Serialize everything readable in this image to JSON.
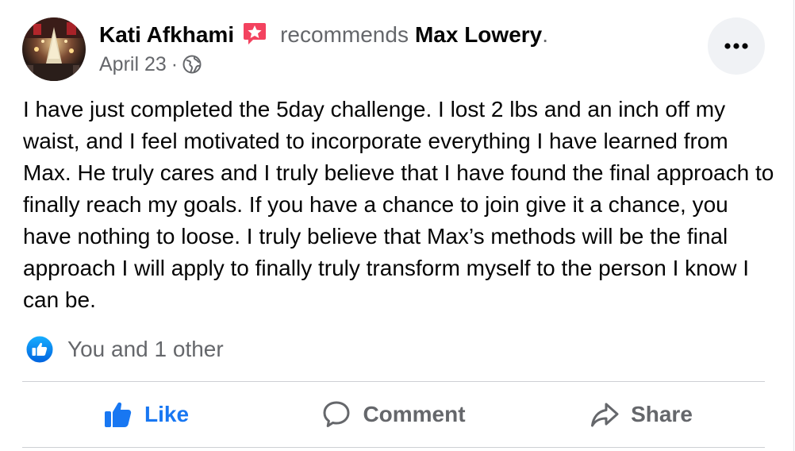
{
  "post": {
    "author": "Kati Afkhami",
    "action_text": "recommends",
    "page_name": "Max Lowery",
    "period": ".",
    "date": "April 23",
    "separator": "·",
    "audience_icon": "globe-icon",
    "more_icon": "more-horizontal-icon",
    "body": "I have just completed the 5day challenge. I lost 2 lbs and an inch off my waist, and I feel motivated to incorporate everything I have learned from Max. He truly cares and I truly believe that I have found the final approach to finally reach my goals. If you have a chance to join give it a chance, you have nothing to loose. I truly believe that Max’s methods will be the final approach I will apply to finally truly transform myself to the person I know I can be."
  },
  "reactions": {
    "icon": "like-reaction-icon",
    "text": "You and 1 other"
  },
  "actions": {
    "like_label": "Like",
    "comment_label": "Comment",
    "share_label": "Share"
  },
  "colors": {
    "facebook_blue": "#1877f2",
    "secondary_text": "#65676b",
    "recommend_badge": "#f3425f",
    "divider": "#ced0d4"
  }
}
